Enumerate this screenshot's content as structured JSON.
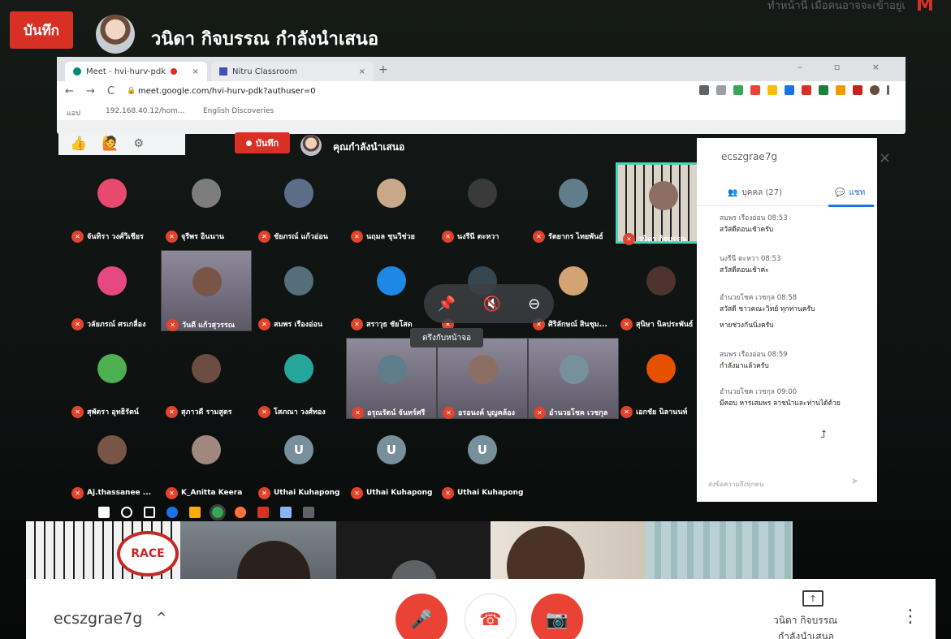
{
  "outer": {
    "record_label": "บันทึก",
    "presenting_text": "วนิดา กิจบรรณ กำลังนำเสนอ",
    "top_right_text": "ทำหน้านี้ เมือคนอาจจะเข้าอยู่เ",
    "gmail_letter": "M"
  },
  "browser": {
    "tabs": [
      {
        "label": "Meet - hvi-hurv-pdk",
        "close": "×"
      },
      {
        "label": "Nitru Classroom",
        "close": "×"
      }
    ],
    "new_tab": "+",
    "window_controls": "– ▫ ×",
    "nav": {
      "back": "←",
      "forward": "→",
      "reload": "C"
    },
    "url": "meet.google.com/hvi-hurv-pdk?authuser=0",
    "bookmarks": [
      "แอป",
      "192.168.40.12/hom...",
      "English Discoveries"
    ]
  },
  "inner_meet": {
    "reactions": [
      "👍",
      "🙋"
    ],
    "settings_icon": "⚙",
    "record_label": "บันทึก",
    "presenting_text": "คุณกำลังนำเสนอ"
  },
  "participants": [
    {
      "name": "จันทิรา วงศ์วิเชียร",
      "avatar": ""
    },
    {
      "name": "จุรีพร อินนาน",
      "avatar": ""
    },
    {
      "name": "ชัยภรณ์ แก้วอ่อน",
      "avatar": ""
    },
    {
      "name": "นฤมล ชุนวิช่วย",
      "avatar": ""
    },
    {
      "name": "นงรีนี ตะหวา",
      "avatar": ""
    },
    {
      "name": "รัตยากร ไทยพันธ์",
      "avatar": ""
    },
    {
      "name": "วนิดา กิจบรรณ",
      "avatar": ""
    },
    {
      "name": "วลัยภรณ์ ศรเกลื่อง",
      "avatar": ""
    },
    {
      "name": "วันดี แก้วสุวรรณ",
      "avatar": ""
    },
    {
      "name": "สมพร เรืองอ่อน",
      "avatar": ""
    },
    {
      "name": "สราวุธ ชัยโสด",
      "avatar": ""
    },
    {
      "name": "",
      "avatar": ""
    },
    {
      "name": "ศิริลักษณ์ สินชุม...",
      "avatar": ""
    },
    {
      "name": "สุนิษา นิลประพันธ์",
      "avatar": ""
    },
    {
      "name": "สุพัตรา อุทธิรัตน์",
      "avatar": ""
    },
    {
      "name": "สุภาวดี รามสูตร",
      "avatar": ""
    },
    {
      "name": "โสภณา วงศ์ทอง",
      "avatar": ""
    },
    {
      "name": "อรุณรัตน์ จันทร์ศรี",
      "avatar": ""
    },
    {
      "name": "อรอนงค์ บุญคล้อง",
      "avatar": ""
    },
    {
      "name": "อำนวยโชค เวชกุล",
      "avatar": ""
    },
    {
      "name": "เอกชัย นิลานนท์",
      "avatar": ""
    },
    {
      "name": "Aj.thassanee ...",
      "avatar": ""
    },
    {
      "name": "K_Anitta Keera",
      "avatar": ""
    },
    {
      "name": "Uthai Kuhapong",
      "avatar": "U"
    },
    {
      "name": "Uthai Kuhapong",
      "avatar": "U"
    },
    {
      "name": "Uthai Kuhapong",
      "avatar": "U"
    }
  ],
  "hover_controls": {
    "pin_icon": "📌",
    "mute_icon": "🔇",
    "remove_icon": "⊖",
    "tooltip": "ตรึงกับหน้าจอ"
  },
  "panel": {
    "title": "ecszgrae7g",
    "close": "×",
    "people_tab": "บุคคล (27)",
    "chat_tab": "แชท",
    "messages": [
      {
        "sender": "สมพร เรืองอ่อน  08:53",
        "text": "สวัสดีตอนเช้าครับ"
      },
      {
        "sender": "นงรีนี ตะหวา  08:53",
        "text": "สวัสดีตอนเช้าค่ะ"
      },
      {
        "sender": "อำนวยโชค เวชกุล  08:58",
        "text": "สวัสดี ชาวคณะวิทย์ ทุกท่านครับ"
      },
      {
        "sender": "",
        "text": "หายช่วงกันนิ่งครับ"
      },
      {
        "sender": "สมพร เรืองอ่อน  08:59",
        "text": "กำลังมาแล้วครับ"
      },
      {
        "sender": "อำนวยโชค เวชกุล  09:00",
        "text": "มีคอบ หารเสมพร ลาชนำและท่านได้ด้วย"
      }
    ],
    "input_placeholder": "ส่งข้อความถึงทุกคน",
    "send_icon": "➤"
  },
  "controls": {
    "meeting_code": "ecszgrae7g",
    "chevron": "^",
    "mic_icon": "🎤",
    "hangup_icon": "☎",
    "camera_icon": "📷",
    "present_icon": "↑",
    "presenter_name": "วนิดา กิจบรรณ",
    "presenter_sub": "กำลังนำเสนอ",
    "more_icon": "⋮"
  },
  "colors": {
    "record_red": "#d93025",
    "accent_blue": "#1a73e8",
    "highlight_teal": "#4fd1b5"
  }
}
